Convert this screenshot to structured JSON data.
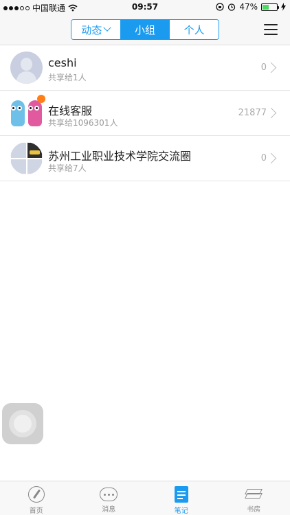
{
  "status_bar": {
    "carrier": "中国联通",
    "time": "09:57",
    "battery": "47%",
    "battery_level": 0.47
  },
  "nav": {
    "segments": [
      "动态",
      "小组",
      "个人"
    ],
    "active_segment": "小组"
  },
  "groups": [
    {
      "title": "ceshi",
      "subtitle": "共享给1人",
      "count": "0",
      "avatar": "default-person-avatar"
    },
    {
      "title": "在线客服",
      "subtitle": "共享给1096301人",
      "count": "21877",
      "avatar": "mascot-avatar",
      "unread_badge": true
    },
    {
      "title": "苏州工业职业技术学院交流圈",
      "subtitle": "共享给7人",
      "count": "0",
      "avatar": "group-grid-avatar"
    }
  ],
  "tab_bar": {
    "tabs": [
      {
        "label": "首页",
        "icon": "compass-icon"
      },
      {
        "label": "消息",
        "icon": "chat-bubble-icon"
      },
      {
        "label": "笔记",
        "icon": "note-icon"
      },
      {
        "label": "书房",
        "icon": "books-icon"
      }
    ],
    "active": "笔记"
  },
  "colors": {
    "accent": "#1a9bf0",
    "badge": "#ff7f16",
    "battery_fill": "#4cd964"
  }
}
